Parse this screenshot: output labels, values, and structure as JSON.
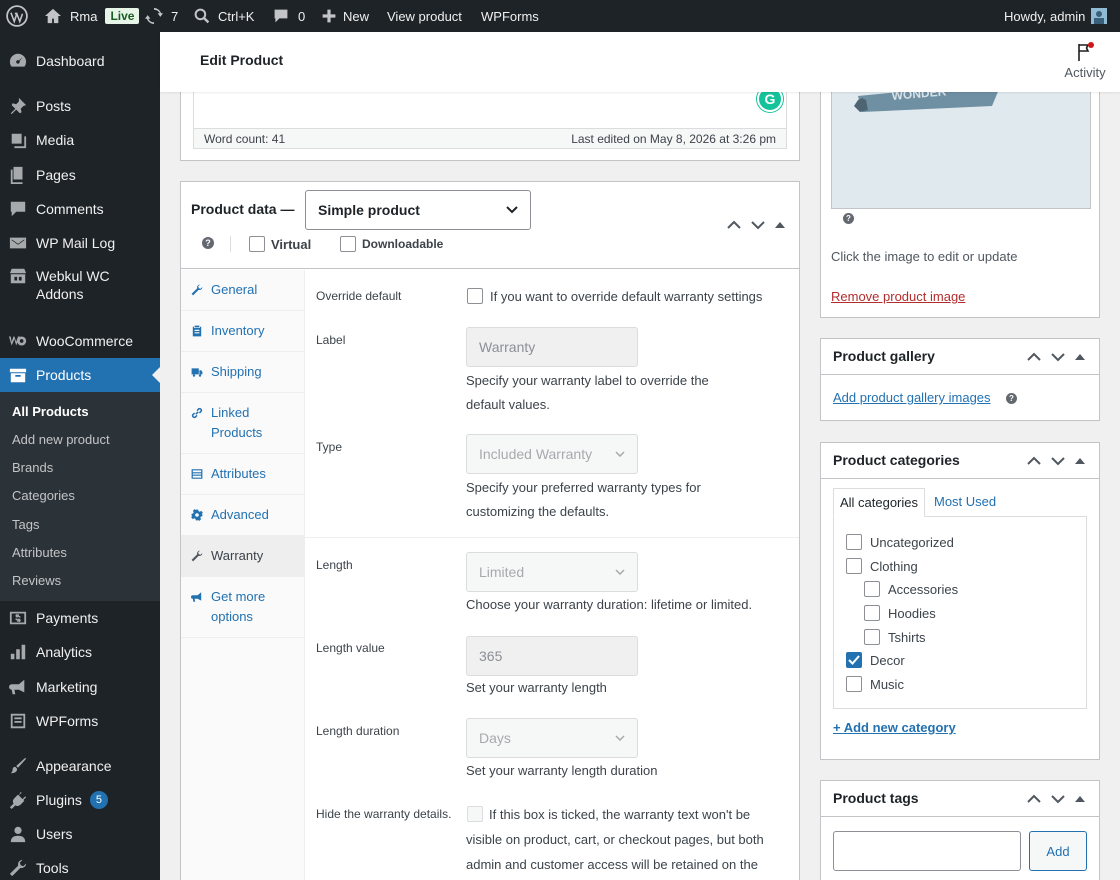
{
  "adminbar": {
    "site_name": "Rma",
    "live_badge": "Live",
    "updates_count": "7",
    "search_shortcut": "Ctrl+K",
    "comments_count": "0",
    "new_label": "New",
    "view_product": "View product",
    "wpforms": "WPForms",
    "howdy": "Howdy, admin"
  },
  "sidebar": {
    "items": [
      {
        "label": "Dashboard",
        "icon": "dashboard-icon"
      },
      {
        "label": "Posts",
        "icon": "pin-icon"
      },
      {
        "label": "Media",
        "icon": "media-icon"
      },
      {
        "label": "Pages",
        "icon": "pages-icon"
      },
      {
        "label": "Comments",
        "icon": "comment-icon"
      },
      {
        "label": "WP Mail Log",
        "icon": "mail-icon"
      },
      {
        "label": "Webkul WC Addons",
        "icon": "store-icon"
      },
      {
        "label": "WooCommerce",
        "icon": "woo-icon"
      },
      {
        "label": "Products",
        "icon": "archive-icon"
      },
      {
        "label": "Payments",
        "icon": "dollar-icon"
      },
      {
        "label": "Analytics",
        "icon": "chart-icon"
      },
      {
        "label": "Marketing",
        "icon": "megaphone-icon"
      },
      {
        "label": "WPForms",
        "icon": "form-icon"
      },
      {
        "label": "Appearance",
        "icon": "brush-icon"
      },
      {
        "label": "Plugins",
        "icon": "plug-icon",
        "badge": "5"
      },
      {
        "label": "Users",
        "icon": "user-icon"
      },
      {
        "label": "Tools",
        "icon": "wrench-icon"
      }
    ],
    "submenu": [
      "All Products",
      "Add new product",
      "Brands",
      "Categories",
      "Tags",
      "Attributes",
      "Reviews"
    ]
  },
  "header": {
    "title": "Edit Product",
    "activity": "Activity"
  },
  "editor": {
    "word_count": "Word count: 41",
    "last_edited": "Last edited on May 8, 2026 at 3:26 pm"
  },
  "product_data": {
    "title": "Product data —",
    "type": "Simple product",
    "virtual": "Virtual",
    "downloadable": "Downloadable",
    "tabs": [
      {
        "label": "General",
        "icon": "wrench-icon"
      },
      {
        "label": "Inventory",
        "icon": "clipboard-icon"
      },
      {
        "label": "Shipping",
        "icon": "truck-icon"
      },
      {
        "label": "Linked Products",
        "icon": "link-icon"
      },
      {
        "label": "Attributes",
        "icon": "list-icon"
      },
      {
        "label": "Advanced",
        "icon": "gear-icon"
      },
      {
        "label": "Warranty",
        "icon": "wrench-icon"
      },
      {
        "label": "Get more options",
        "icon": "megaphone-icon"
      }
    ],
    "fields": {
      "override_label": "Override default",
      "override_text": "If you want to override default warranty settings",
      "label_label": "Label",
      "label_value": "Warranty",
      "label_desc": "Specify your warranty label to override the default values.",
      "type_label": "Type",
      "type_value": "Included Warranty",
      "type_desc": "Specify your preferred warranty types for customizing the defaults.",
      "length_label": "Length",
      "length_value": "Limited",
      "length_desc": "Choose your warranty duration: lifetime or limited.",
      "length_value_label": "Length value",
      "length_value_value": "365",
      "length_value_desc": "Set your warranty length",
      "length_duration_label": "Length duration",
      "length_duration_value": "Days",
      "length_duration_desc": "Set your warranty length duration",
      "hide_label": "Hide the warranty details.",
      "hide_text": "If this box is ticked, the warranty text won't be visible on product, cart, or checkout pages, but both admin and customer access will be retained on the"
    }
  },
  "image_box": {
    "hint": "Click the image to edit or update",
    "remove": "Remove product image"
  },
  "gallery_box": {
    "title": "Product gallery",
    "add": "Add product gallery images"
  },
  "categories_box": {
    "title": "Product categories",
    "tab_all": "All categories",
    "tab_used": "Most Used",
    "items": [
      {
        "label": "Uncategorized",
        "checked": false
      },
      {
        "label": "Clothing",
        "checked": false
      },
      {
        "label": "Accessories",
        "checked": false
      },
      {
        "label": "Hoodies",
        "checked": false
      },
      {
        "label": "Tshirts",
        "checked": false
      },
      {
        "label": "Decor",
        "checked": true
      },
      {
        "label": "Music",
        "checked": false
      }
    ],
    "add_new": "+ Add new category"
  },
  "tags_box": {
    "title": "Product tags",
    "add": "Add"
  },
  "colors": {
    "accent": "#2271b1",
    "sidebar": "#1d2327",
    "badge": "#2271b1",
    "danger": "#b32d2e"
  }
}
